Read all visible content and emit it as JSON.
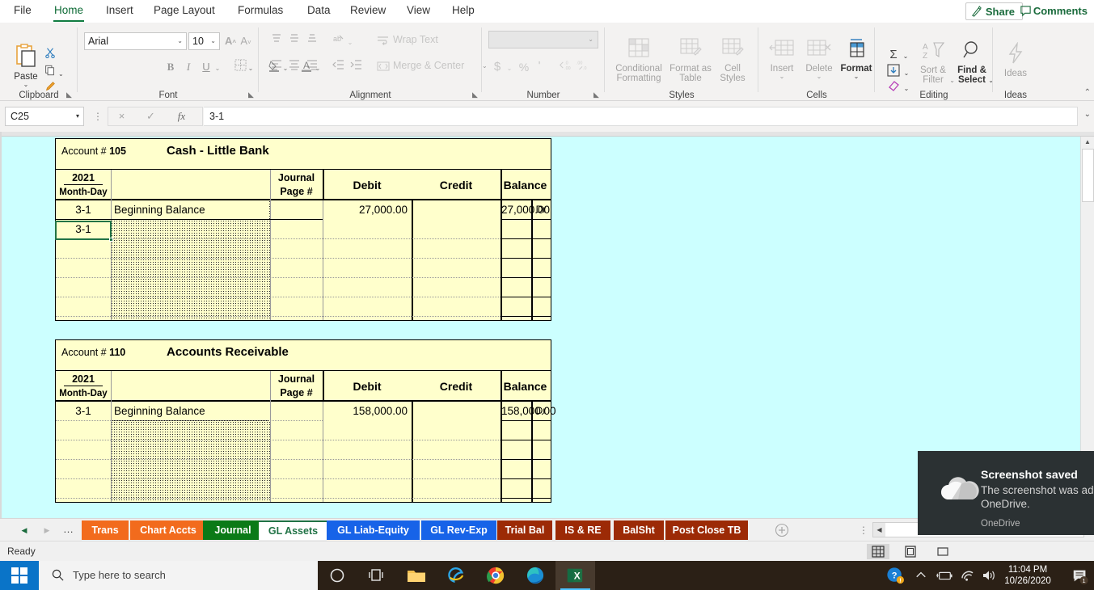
{
  "ribbon": {
    "tabs": [
      {
        "label": "File",
        "active": false
      },
      {
        "label": "Home",
        "active": true
      },
      {
        "label": "Insert",
        "active": false
      },
      {
        "label": "Page Layout",
        "active": false
      },
      {
        "label": "Formulas",
        "active": false
      },
      {
        "label": "Data",
        "active": false
      },
      {
        "label": "Review",
        "active": false
      },
      {
        "label": "View",
        "active": false
      },
      {
        "label": "Help",
        "active": false
      }
    ],
    "share_label": "Share",
    "comments_label": "Comments",
    "groups": {
      "clipboard": "Clipboard",
      "font": "Font",
      "alignment": "Alignment",
      "number": "Number",
      "styles": "Styles",
      "cells": "Cells",
      "editing": "Editing",
      "ideas": "Ideas"
    },
    "clipboard": {
      "paste": "Paste"
    },
    "font": {
      "name_value": "Arial",
      "size_value": "10",
      "bold": "B",
      "italic": "I",
      "underline": "U"
    },
    "alignment": {
      "wrap_text": "Wrap Text",
      "merge_center": "Merge & Center"
    },
    "number": {
      "format_value": "",
      "currency": "$",
      "percent": "%",
      "comma": "'"
    },
    "styles": {
      "conditional_formatting": "Conditional\nFormatting",
      "conditional_formatting_l1": "Conditional",
      "conditional_formatting_l2": "Formatting",
      "format_as_table_l1": "Format as",
      "format_as_table_l2": "Table",
      "cell_styles_l1": "Cell",
      "cell_styles_l2": "Styles"
    },
    "cells": {
      "insert": "Insert",
      "delete": "Delete",
      "format": "Format"
    },
    "editing": {
      "sort_filter_l1": "Sort &",
      "sort_filter_l2": "Filter",
      "find_select_l1": "Find &",
      "find_select_l2": "Select"
    },
    "ideas": {
      "label": "Ideas"
    }
  },
  "formula_bar": {
    "name_box_value": "C25",
    "cancel_icon": "×",
    "enter_icon": "✓",
    "fx_icon": "fx",
    "formula_value": "3-1"
  },
  "accent": {
    "excel_green": "#217346",
    "sheet_bg": "#CCFFFF",
    "ledger_bg": "#FFFFCC",
    "selection": "#217346"
  },
  "ledgers": [
    {
      "account_label": "Account #",
      "account_number": "105",
      "account_name": "Cash - Little Bank",
      "headers": {
        "year": "2021",
        "monthday": "Month-Day",
        "description": "",
        "journal_l1": "Journal",
        "journal_l2": "Page #",
        "debit": "Debit",
        "credit": "Credit",
        "balance": "Balance"
      },
      "rows": [
        {
          "date": "3-1",
          "desc": "Beginning Balance",
          "page": "",
          "debit": "27,000.00",
          "credit": "",
          "balance": "27,000.00",
          "drcr": "Dr"
        },
        {
          "date": "3-1",
          "desc": "",
          "page": "",
          "debit": "",
          "credit": "",
          "balance": "",
          "drcr": ""
        },
        {
          "date": "",
          "desc": "",
          "page": "",
          "debit": "",
          "credit": "",
          "balance": "",
          "drcr": ""
        },
        {
          "date": "",
          "desc": "",
          "page": "",
          "debit": "",
          "credit": "",
          "balance": "",
          "drcr": ""
        },
        {
          "date": "",
          "desc": "",
          "page": "",
          "debit": "",
          "credit": "",
          "balance": "",
          "drcr": ""
        },
        {
          "date": "",
          "desc": "",
          "page": "",
          "debit": "",
          "credit": "",
          "balance": "",
          "drcr": ""
        },
        {
          "date": "",
          "desc": "",
          "page": "",
          "debit": "",
          "credit": "",
          "balance": "",
          "drcr": ""
        }
      ]
    },
    {
      "account_label": "Account #",
      "account_number": "110",
      "account_name": "Accounts Receivable",
      "headers": {
        "year": "2021",
        "monthday": "Month-Day",
        "description": "",
        "journal_l1": "Journal",
        "journal_l2": "Page #",
        "debit": "Debit",
        "credit": "Credit",
        "balance": "Balance"
      },
      "rows": [
        {
          "date": "3-1",
          "desc": "Beginning Balance",
          "page": "",
          "debit": "158,000.00",
          "credit": "",
          "balance": "158,000.00",
          "drcr": "Dr"
        },
        {
          "date": "",
          "desc": "",
          "page": "",
          "debit": "",
          "credit": "",
          "balance": "",
          "drcr": ""
        },
        {
          "date": "",
          "desc": "",
          "page": "",
          "debit": "",
          "credit": "",
          "balance": "",
          "drcr": ""
        },
        {
          "date": "",
          "desc": "",
          "page": "",
          "debit": "",
          "credit": "",
          "balance": "",
          "drcr": ""
        },
        {
          "date": "",
          "desc": "",
          "page": "",
          "debit": "",
          "credit": "",
          "balance": "",
          "drcr": ""
        },
        {
          "date": "",
          "desc": "",
          "page": "",
          "debit": "",
          "credit": "",
          "balance": "",
          "drcr": ""
        }
      ]
    }
  ],
  "sheet_tabs": [
    {
      "label": "Trans",
      "bg": "#F26B1D",
      "color": "#ffffff",
      "active": false
    },
    {
      "label": "Chart Accts",
      "bg": "#F26B1D",
      "color": "#ffffff",
      "active": false
    },
    {
      "label": "Journal",
      "bg": "#0B7A17",
      "color": "#ffffff",
      "active": false
    },
    {
      "label": "GL Assets",
      "bg": "#ffffff",
      "color": "#217346",
      "active": true
    },
    {
      "label": "GL Liab-Equity",
      "bg": "#1763E8",
      "color": "#ffffff",
      "active": false
    },
    {
      "label": "GL Rev-Exp",
      "bg": "#1763E8",
      "color": "#ffffff",
      "active": false
    },
    {
      "label": "Trial Bal",
      "bg": "#9C2A06",
      "color": "#ffffff",
      "active": false
    },
    {
      "label": "IS & RE",
      "bg": "#9C2A06",
      "color": "#ffffff",
      "active": false
    },
    {
      "label": "BalSht",
      "bg": "#9C2A06",
      "color": "#ffffff",
      "active": false
    },
    {
      "label": "Post Close TB",
      "bg": "#9C2A06",
      "color": "#ffffff",
      "active": false
    }
  ],
  "status_bar": {
    "mode": "Ready"
  },
  "toast": {
    "title": "Screenshot saved",
    "body": "The screenshot was added to OneDrive.",
    "app": "OneDrive"
  },
  "taskbar": {
    "search_placeholder": "Type here to search",
    "time": "11:04 PM",
    "date": "10/26/2020",
    "notification_count": "1"
  }
}
